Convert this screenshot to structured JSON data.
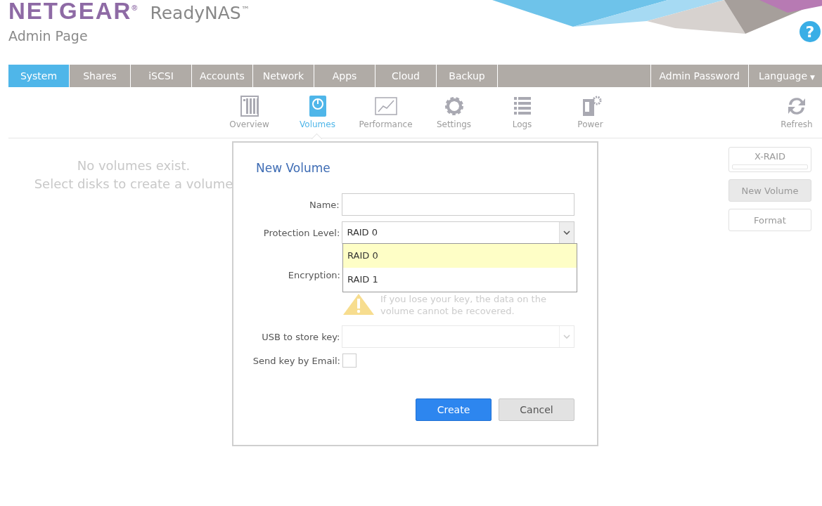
{
  "brand": {
    "logo": "NETGEAR",
    "logo_mark": "®",
    "product": "ReadyNAS",
    "product_mark": "™",
    "subtitle": "Admin Page",
    "help": "?"
  },
  "tabs": [
    {
      "label": "System",
      "selected": true
    },
    {
      "label": "Shares",
      "selected": false
    },
    {
      "label": "iSCSI",
      "selected": false
    },
    {
      "label": "Accounts",
      "selected": false
    },
    {
      "label": "Network",
      "selected": false
    },
    {
      "label": "Apps",
      "selected": false
    },
    {
      "label": "Cloud",
      "selected": false
    },
    {
      "label": "Backup",
      "selected": false
    }
  ],
  "right_tabs": [
    {
      "label": "Admin Password",
      "kind": "plain"
    },
    {
      "label": "Language",
      "kind": "menu",
      "caret": "▼"
    }
  ],
  "subtabs": [
    {
      "label": "Overview",
      "selected": false
    },
    {
      "label": "Volumes",
      "selected": true
    },
    {
      "label": "Performance",
      "selected": false
    },
    {
      "label": "Settings",
      "selected": false
    },
    {
      "label": "Logs",
      "selected": false
    },
    {
      "label": "Power",
      "selected": false
    }
  ],
  "refresh": "Refresh",
  "empty_message": [
    "No volumes exist.",
    "Select disks to create a volume"
  ],
  "side_buttons": [
    {
      "label": "X-RAID",
      "kind": "toggle"
    },
    {
      "label": "New Volume",
      "kind": "button",
      "disabled": true
    },
    {
      "label": "Format",
      "kind": "button",
      "disabled": false
    }
  ],
  "dialog": {
    "title": "New Volume",
    "name": {
      "label": "Name:"
    },
    "protection": {
      "label": "Protection Level:",
      "value": "RAID 0",
      "options": [
        {
          "label": "RAID 0",
          "selected": true
        },
        {
          "label": "RAID 1",
          "selected": false
        }
      ]
    },
    "encryption": {
      "label": "Encryption:",
      "warning": [
        "If you lose your key, the data on the",
        "volume cannot be recovered."
      ]
    },
    "usb": {
      "label": "USB to store key:",
      "disabled": true
    },
    "email": {
      "label": "Send key by Email:",
      "checked": false
    },
    "buttons": [
      {
        "label": "Create",
        "kind": "primary"
      },
      {
        "label": "Cancel",
        "kind": "secondary"
      }
    ]
  }
}
